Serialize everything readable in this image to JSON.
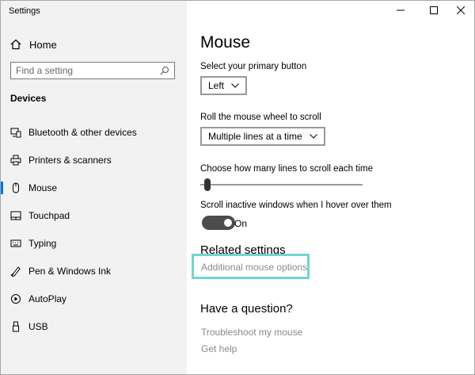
{
  "window": {
    "title": "Settings",
    "controls": [
      "minimize",
      "maximize",
      "close"
    ]
  },
  "sidebar": {
    "home_label": "Home",
    "search_placeholder": "Find a setting",
    "section_label": "Devices",
    "items": [
      {
        "label": "Bluetooth & other devices",
        "icon": "bluetooth-devices-icon"
      },
      {
        "label": "Printers & scanners",
        "icon": "printer-icon"
      },
      {
        "label": "Mouse",
        "icon": "mouse-icon",
        "selected": true
      },
      {
        "label": "Touchpad",
        "icon": "touchpad-icon"
      },
      {
        "label": "Typing",
        "icon": "keyboard-icon"
      },
      {
        "label": "Pen & Windows Ink",
        "icon": "pen-icon"
      },
      {
        "label": "AutoPlay",
        "icon": "autoplay-icon"
      },
      {
        "label": "USB",
        "icon": "usb-icon"
      }
    ]
  },
  "main": {
    "title": "Mouse",
    "primary_button": {
      "label": "Select your primary button",
      "value": "Left"
    },
    "scroll_wheel": {
      "label": "Roll the mouse wheel to scroll",
      "value": "Multiple lines at a time"
    },
    "lines_to_scroll": {
      "label": "Choose how many lines to scroll each time",
      "level": 0.03
    },
    "inactive_scroll": {
      "label": "Scroll inactive windows when I hover over them",
      "state": "On"
    },
    "related": {
      "heading": "Related settings",
      "link": "Additional mouse options"
    },
    "question": {
      "heading": "Have a question?",
      "links": [
        "Troubleshoot my mouse",
        "Get help"
      ]
    }
  },
  "colors": {
    "sidebar_bg": "#f2f2f2",
    "accent": "#0078d7",
    "highlight": "#73d3cf",
    "link": "#8a8a8a",
    "toggle_on": "#4c4c4c"
  }
}
